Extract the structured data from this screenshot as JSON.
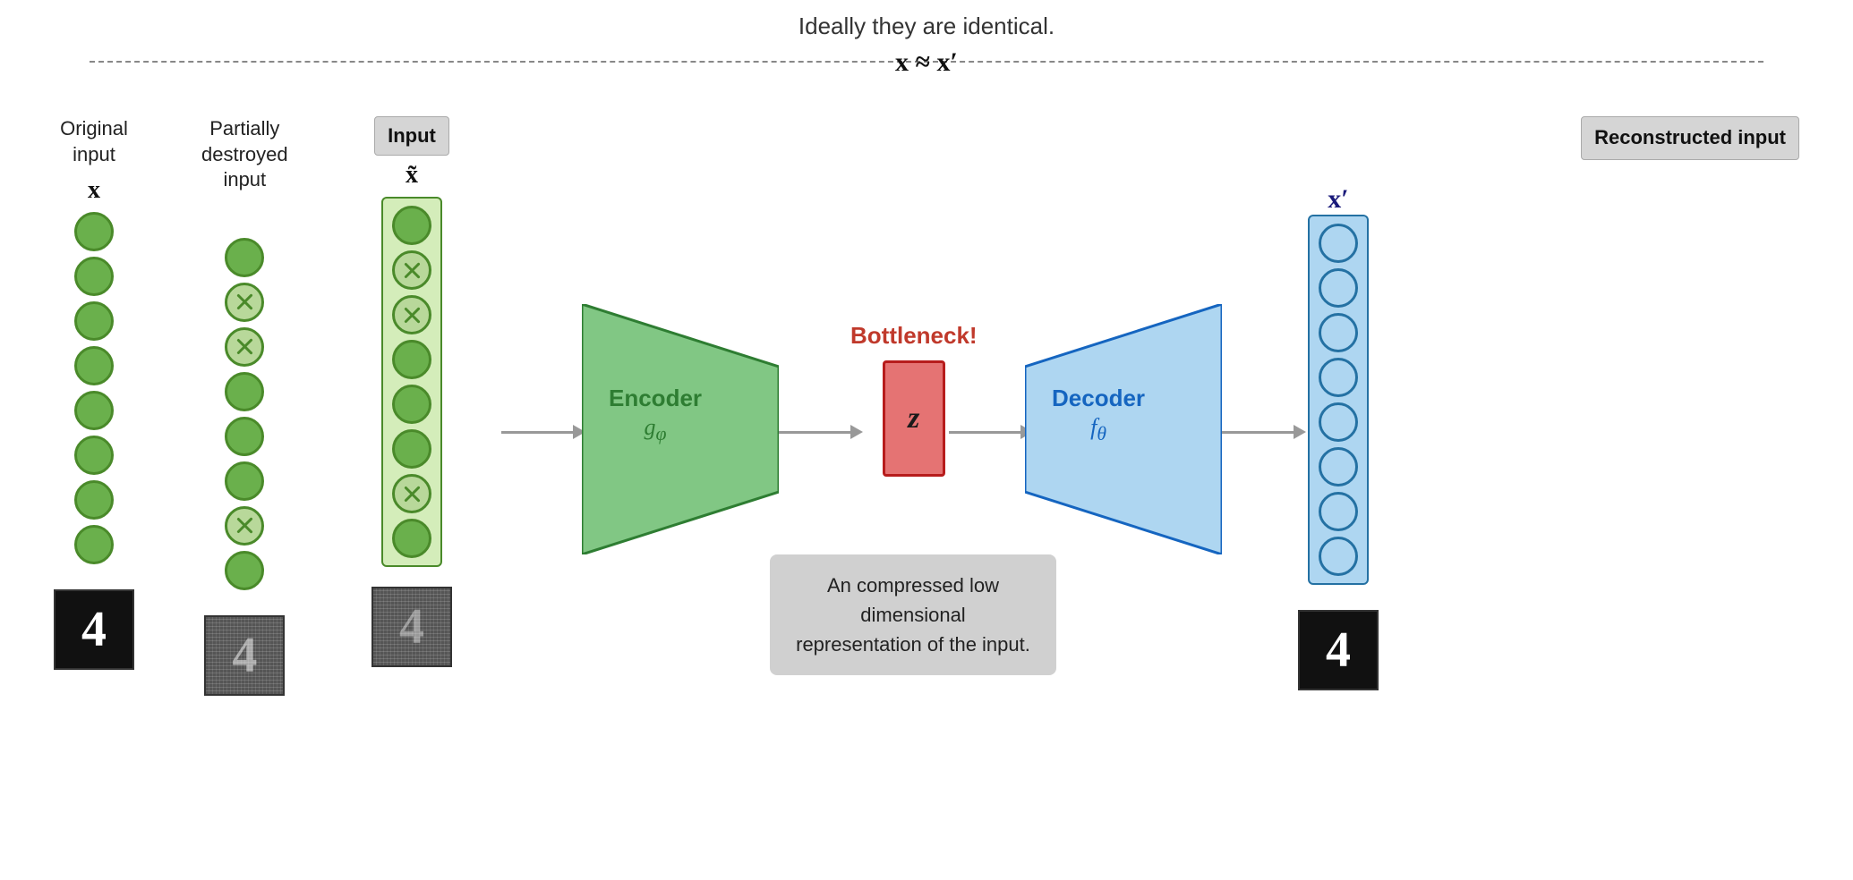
{
  "diagram": {
    "top_text": "Ideally they are identical.",
    "top_equation": "x ≈ x′",
    "col_original_label": "Original\ninput",
    "col_original_math": "x",
    "col_destroyed_label": "Partially\ndestroyed\ninput",
    "col_input_label": "Input",
    "col_input_math": "x̃",
    "encoder_label": "Encoder",
    "encoder_sublabel": "g_φ",
    "bottleneck_label": "Bottleneck!",
    "z_label": "z",
    "tooltip_text": "An compressed low dimensional\nrepresentation of the input.",
    "decoder_label": "Decoder",
    "decoder_sublabel": "f_θ",
    "output_math": "x′",
    "reconstructed_label": "Reconstructed\ninput",
    "nodes_original": [
      "solid",
      "solid",
      "solid",
      "solid",
      "solid",
      "solid",
      "solid",
      "solid"
    ],
    "nodes_destroyed": [
      "solid",
      "x",
      "x",
      "solid",
      "solid",
      "solid",
      "x",
      "solid"
    ],
    "nodes_input": [
      "solid",
      "x",
      "x",
      "solid",
      "solid",
      "solid",
      "x",
      "solid"
    ]
  }
}
